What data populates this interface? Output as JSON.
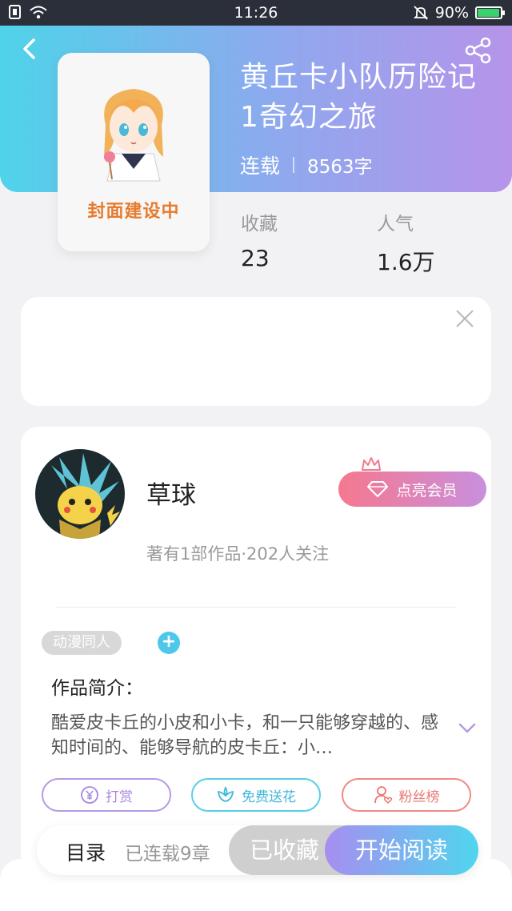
{
  "status_bar": {
    "time": "11:26",
    "battery": "90%",
    "battery_level": 0.9
  },
  "book": {
    "cover_label": "封面建设中",
    "title": "黄丘卡小队历险记1奇幻之旅",
    "status": "连载",
    "word_count": "8563字",
    "stats": [
      {
        "label": "收藏",
        "value": "23"
      },
      {
        "label": "人气",
        "value": "1.6万"
      }
    ]
  },
  "author": {
    "name": "草球",
    "vip_label": "点亮会员",
    "summary": "著有1部作品·202人关注"
  },
  "work": {
    "tag": "动漫同人",
    "intro_title": "作品简介：",
    "intro_text": "酷爱皮卡丘的小皮和小卡，和一只能够穿越的、感知时间的、能够导航的皮卡丘：小…"
  },
  "actions": {
    "reward": "打赏",
    "flower": "免费送花",
    "fans": "粉丝榜"
  },
  "bottom_bar": {
    "toc": "目录",
    "chapters": "已连载9章",
    "collected": "已收藏",
    "start_reading": "开始阅读"
  },
  "colors": {
    "header_start": "#4fd3ea",
    "header_end": "#b694ea",
    "vip_start": "#f5788e",
    "vip_end": "#c98fde",
    "read_start": "#a78ef0",
    "read_end": "#4fd6ee"
  },
  "icons": [
    "back-icon",
    "share-icon",
    "close-icon",
    "crown-icon",
    "diamond-icon",
    "plus-icon",
    "chevron-down-icon",
    "yen-icon",
    "flower-icon",
    "user-heart-icon",
    "wifi-icon",
    "mute-bell-icon",
    "battery-icon"
  ]
}
